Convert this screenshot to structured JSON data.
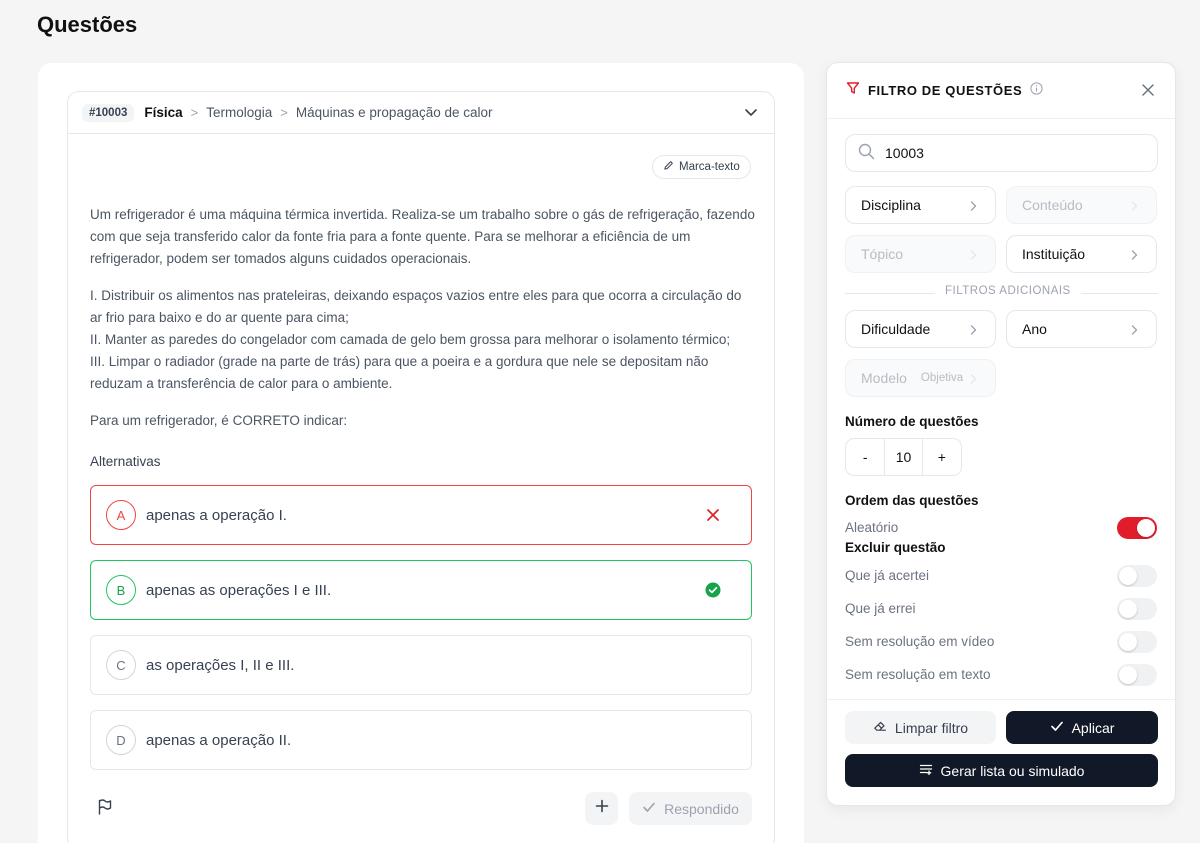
{
  "page": {
    "title": "Questões"
  },
  "question": {
    "id": "#10003",
    "breadcrumb": {
      "discipline": "Física",
      "content": "Termologia",
      "topic": "Máquinas e propagação de calor"
    },
    "highlighter_label": "Marca-texto",
    "paragraphs": [
      "Um refrigerador é uma máquina térmica invertida. Realiza-se um trabalho sobre o gás de refrigeração, fazendo com que seja transferido calor da fonte fria para a fonte quente. Para se melhorar a eficiência de um refrigerador, podem ser tomados alguns cuidados operacionais.",
      "I. Distribuir os alimentos nas prateleiras, deixando espaços vazios entre eles para que ocorra a circulação do ar frio para baixo e do ar quente para cima;",
      "II. Manter as paredes do congelador com camada de gelo bem grossa para melhorar o isolamento térmico;",
      "III. Limpar o radiador (grade na parte de trás) para que a poeira e a gordura que nele se depositam não reduzam a transferência de calor para o ambiente.",
      "Para um refrigerador, é CORRETO indicar:"
    ],
    "alternatives_title": "Alternativas",
    "alternatives": [
      {
        "letter": "A",
        "text": "apenas a operação I.",
        "state": "wrong"
      },
      {
        "letter": "B",
        "text": "apenas as operações I e III.",
        "state": "correct"
      },
      {
        "letter": "C",
        "text": "as operações I, II e III.",
        "state": "none"
      },
      {
        "letter": "D",
        "text": "apenas a operação II.",
        "state": "none"
      }
    ],
    "answered_label": "Respondido"
  },
  "filter": {
    "title": "FILTRO DE QUESTÕES",
    "search_value": "10003",
    "buttons": {
      "discipline": "Disciplina",
      "content": "Conteúdo",
      "topic": "Tópico",
      "institution": "Instituição",
      "difficulty": "Dificuldade",
      "year": "Ano",
      "model": "Modelo",
      "model_value": "Objetiva"
    },
    "additional_label": "FILTROS ADICIONAIS",
    "count_label": "Número de questões",
    "count_minus": "-",
    "count_value": "10",
    "count_plus": "+",
    "order_label": "Ordem das questões",
    "random_label": "Aleatório",
    "random_on": true,
    "exclude_label": "Excluir questão",
    "exclude_options": [
      {
        "label": "Que já acertei",
        "on": false
      },
      {
        "label": "Que já errei",
        "on": false
      },
      {
        "label": "Sem resolução em vídeo",
        "on": false
      },
      {
        "label": "Sem resolução em texto",
        "on": false
      }
    ],
    "clear_label": "Limpar filtro",
    "apply_label": "Aplicar",
    "generate_label": "Gerar lista ou simulado"
  },
  "colors": {
    "accent_red": "#e11d2b",
    "correct_green": "#22c55e",
    "dark_button": "#111827"
  }
}
